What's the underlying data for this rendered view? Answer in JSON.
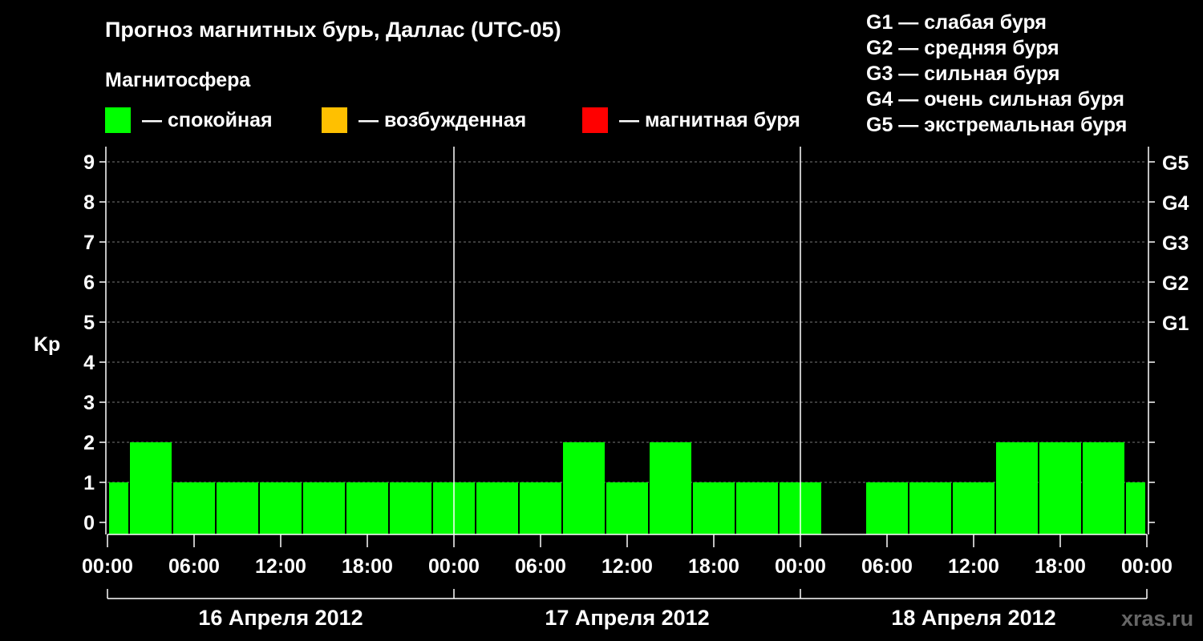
{
  "title": "Прогноз магнитных бурь, Даллас (UTC-05)",
  "magnetosphere_label": "Магнитосфера",
  "status_legend": [
    {
      "label": "— спокойная",
      "color": "#00ff00"
    },
    {
      "label": "— возбужденная",
      "color": "#ffc000"
    },
    {
      "label": "— магнитная буря",
      "color": "#ff0000"
    }
  ],
  "g_legend": [
    "G1 — слабая буря",
    "G2 — средняя буря",
    "G3 — сильная буря",
    "G4 — очень сильная буря",
    "G5 — экстремальная буря"
  ],
  "watermark": "xras.ru",
  "chart_data": {
    "type": "bar",
    "ylabel": "Kp",
    "ylim": [
      0,
      9
    ],
    "yticks": [
      0,
      1,
      2,
      3,
      4,
      5,
      6,
      7,
      8,
      9
    ],
    "right_axis_labels": [
      {
        "kp": 5,
        "label": "G1"
      },
      {
        "kp": 6,
        "label": "G2"
      },
      {
        "kp": 7,
        "label": "G3"
      },
      {
        "kp": 8,
        "label": "G4"
      },
      {
        "kp": 9,
        "label": "G5"
      }
    ],
    "xtick_labels": [
      "00:00",
      "06:00",
      "12:00",
      "18:00",
      "00:00",
      "06:00",
      "12:00",
      "18:00",
      "00:00",
      "06:00",
      "12:00",
      "18:00",
      "00:00"
    ],
    "days": [
      "16 Апреля 2012",
      "17 Апреля 2012",
      "18 Апреля 2012"
    ],
    "bar_color": "#00ff00",
    "bars": [
      {
        "start_hour": 0,
        "end_hour": 1.5,
        "kp": 1
      },
      {
        "start_hour": 1.5,
        "end_hour": 4.5,
        "kp": 2
      },
      {
        "start_hour": 4.5,
        "end_hour": 7.5,
        "kp": 1
      },
      {
        "start_hour": 7.5,
        "end_hour": 10.5,
        "kp": 1
      },
      {
        "start_hour": 10.5,
        "end_hour": 13.5,
        "kp": 1
      },
      {
        "start_hour": 13.5,
        "end_hour": 16.5,
        "kp": 1
      },
      {
        "start_hour": 16.5,
        "end_hour": 19.5,
        "kp": 1
      },
      {
        "start_hour": 19.5,
        "end_hour": 22.5,
        "kp": 1
      },
      {
        "start_hour": 22.5,
        "end_hour": 25.5,
        "kp": 1
      },
      {
        "start_hour": 25.5,
        "end_hour": 28.5,
        "kp": 1
      },
      {
        "start_hour": 28.5,
        "end_hour": 31.5,
        "kp": 1
      },
      {
        "start_hour": 31.5,
        "end_hour": 34.5,
        "kp": 2
      },
      {
        "start_hour": 34.5,
        "end_hour": 37.5,
        "kp": 1
      },
      {
        "start_hour": 37.5,
        "end_hour": 40.5,
        "kp": 2
      },
      {
        "start_hour": 40.5,
        "end_hour": 43.5,
        "kp": 1
      },
      {
        "start_hour": 43.5,
        "end_hour": 46.5,
        "kp": 1
      },
      {
        "start_hour": 46.5,
        "end_hour": 49.5,
        "kp": 1
      },
      {
        "start_hour": 52.5,
        "end_hour": 55.5,
        "kp": 1
      },
      {
        "start_hour": 55.5,
        "end_hour": 58.5,
        "kp": 1
      },
      {
        "start_hour": 58.5,
        "end_hour": 61.5,
        "kp": 1
      },
      {
        "start_hour": 61.5,
        "end_hour": 64.5,
        "kp": 2
      },
      {
        "start_hour": 64.5,
        "end_hour": 67.5,
        "kp": 2
      },
      {
        "start_hour": 67.5,
        "end_hour": 70.5,
        "kp": 2
      },
      {
        "start_hour": 70.5,
        "end_hour": 72,
        "kp": 1
      }
    ]
  }
}
